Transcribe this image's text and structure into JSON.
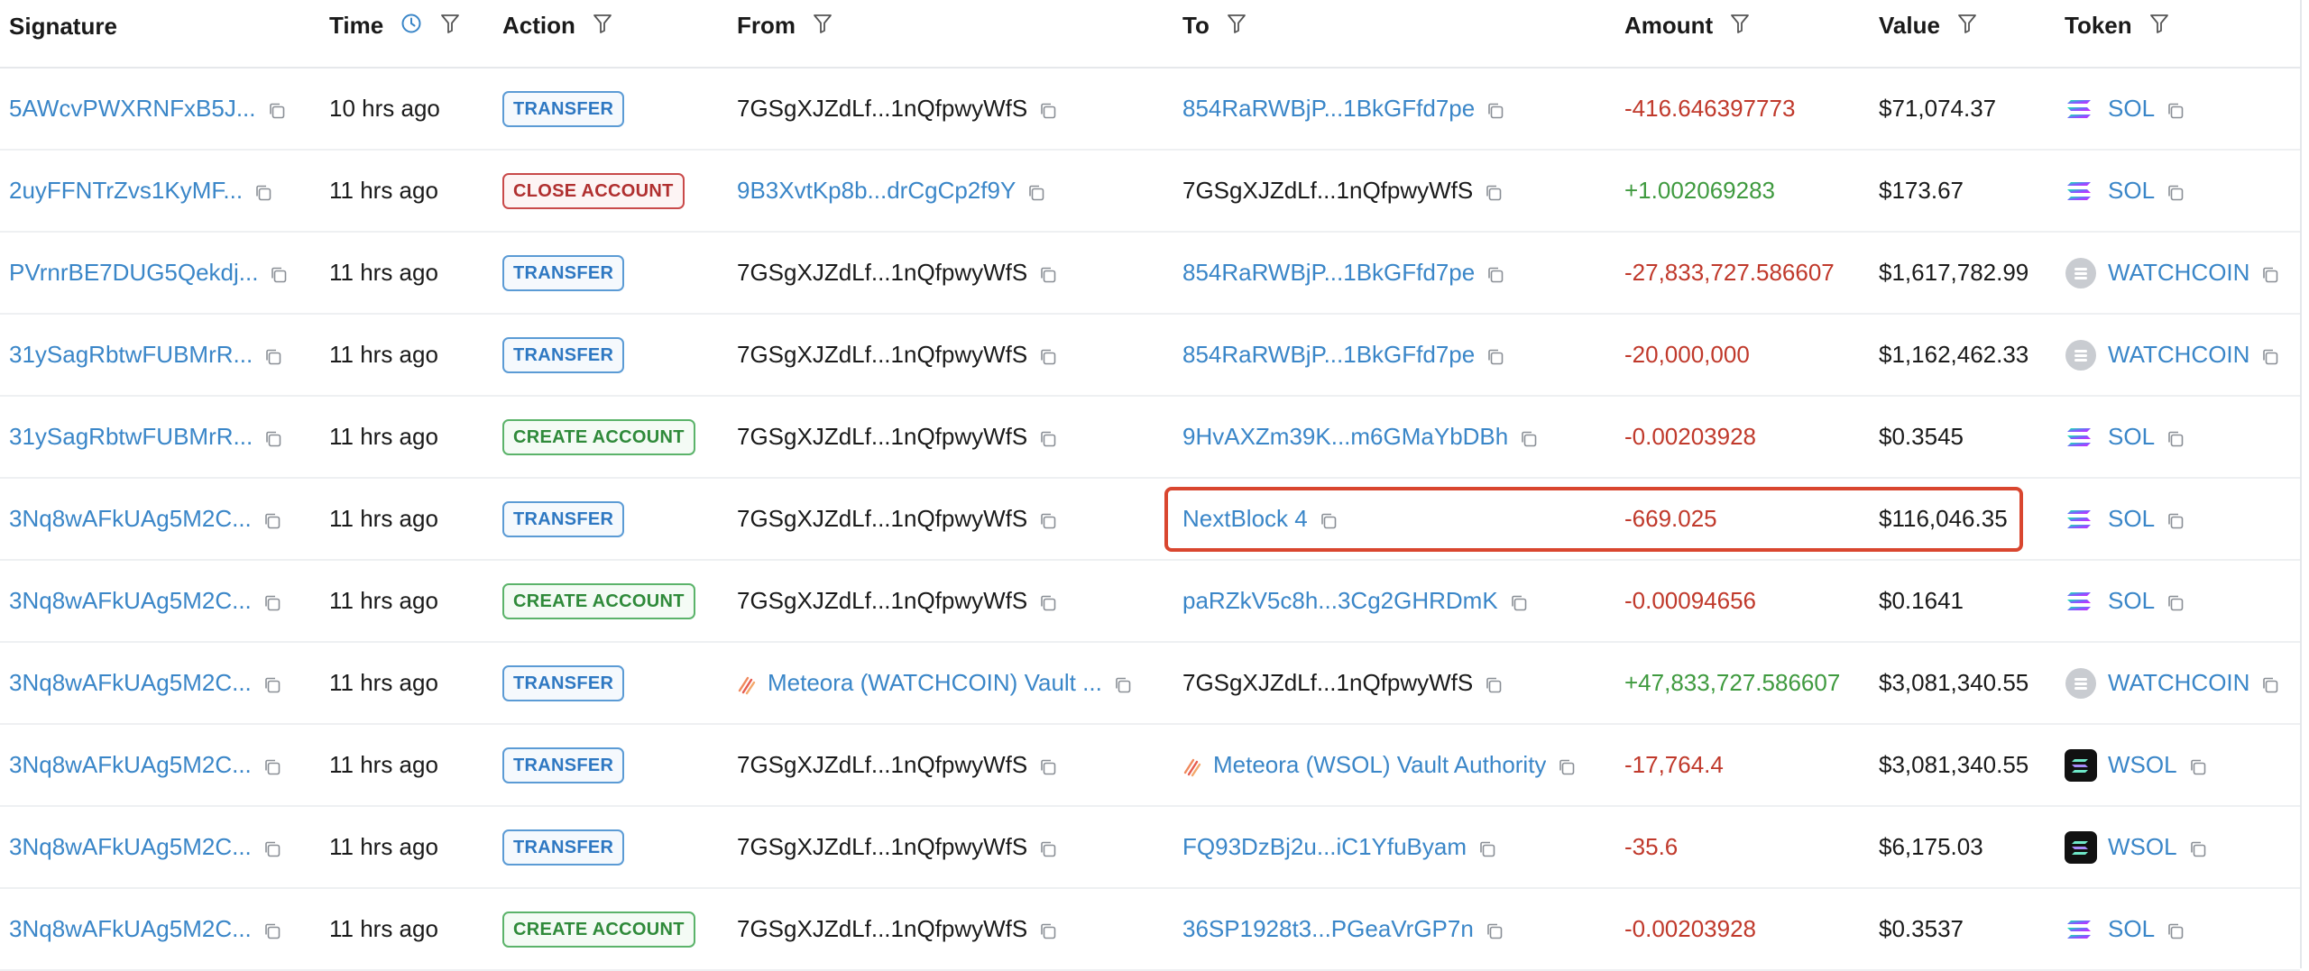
{
  "table": {
    "headers": {
      "signature": "Signature",
      "time": "Time",
      "action": "Action",
      "from": "From",
      "to": "To",
      "amount": "Amount",
      "value": "Value",
      "token": "Token"
    },
    "rows": [
      {
        "signature": "5AWcvPWXRNFxB5J...",
        "time": "10 hrs ago",
        "action": "TRANSFER",
        "action_type": "transfer",
        "from": "7GSgXJZdLf...1nQfpwyWfS",
        "from_link": false,
        "from_meteora": false,
        "to": "854RaRWBjP...1BkGFfd7pe",
        "to_link": true,
        "to_meteora": false,
        "amount": "-416.646397773",
        "amount_sign": "neg",
        "value": "$71,074.37",
        "token": "SOL",
        "token_icon": "sol-icon"
      },
      {
        "signature": "2uyFFNTrZvs1KyMF...",
        "time": "11 hrs ago",
        "action": "CLOSE ACCOUNT",
        "action_type": "close",
        "from": "9B3XvtKp8b...drCgCp2f9Y",
        "from_link": true,
        "from_meteora": false,
        "to": "7GSgXJZdLf...1nQfpwyWfS",
        "to_link": false,
        "to_meteora": false,
        "amount": "+1.002069283",
        "amount_sign": "pos",
        "value": "$173.67",
        "token": "SOL",
        "token_icon": "sol-icon"
      },
      {
        "signature": "PVrnrBE7DUG5Qekdj...",
        "time": "11 hrs ago",
        "action": "TRANSFER",
        "action_type": "transfer",
        "from": "7GSgXJZdLf...1nQfpwyWfS",
        "from_link": false,
        "from_meteora": false,
        "to": "854RaRWBjP...1BkGFfd7pe",
        "to_link": true,
        "to_meteora": false,
        "amount": "-27,833,727.586607",
        "amount_sign": "neg",
        "value": "$1,617,782.99",
        "token": "WATCHCOIN",
        "token_icon": "watchcoin-icon"
      },
      {
        "signature": "31ySagRbtwFUBMrR...",
        "time": "11 hrs ago",
        "action": "TRANSFER",
        "action_type": "transfer",
        "from": "7GSgXJZdLf...1nQfpwyWfS",
        "from_link": false,
        "from_meteora": false,
        "to": "854RaRWBjP...1BkGFfd7pe",
        "to_link": true,
        "to_meteora": false,
        "amount": "-20,000,000",
        "amount_sign": "neg",
        "value": "$1,162,462.33",
        "token": "WATCHCOIN",
        "token_icon": "watchcoin-icon"
      },
      {
        "signature": "31ySagRbtwFUBMrR...",
        "time": "11 hrs ago",
        "action": "CREATE ACCOUNT",
        "action_type": "create",
        "from": "7GSgXJZdLf...1nQfpwyWfS",
        "from_link": false,
        "from_meteora": false,
        "to": "9HvAXZm39K...m6GMaYbDBh",
        "to_link": true,
        "to_meteora": false,
        "amount": "-0.00203928",
        "amount_sign": "neg",
        "value": "$0.3545",
        "token": "SOL",
        "token_icon": "sol-icon"
      },
      {
        "signature": "3Nq8wAFkUAg5M2C...",
        "time": "11 hrs ago",
        "action": "TRANSFER",
        "action_type": "transfer",
        "from": "7GSgXJZdLf...1nQfpwyWfS",
        "from_link": false,
        "from_meteora": false,
        "to": "NextBlock 4",
        "to_link": true,
        "to_meteora": false,
        "amount": "-669.025",
        "amount_sign": "neg",
        "value": "$116,046.35",
        "token": "SOL",
        "token_icon": "sol-icon"
      },
      {
        "signature": "3Nq8wAFkUAg5M2C...",
        "time": "11 hrs ago",
        "action": "CREATE ACCOUNT",
        "action_type": "create",
        "from": "7GSgXJZdLf...1nQfpwyWfS",
        "from_link": false,
        "from_meteora": false,
        "to": "paRZkV5c8h...3Cg2GHRDmK",
        "to_link": true,
        "to_meteora": false,
        "amount": "-0.00094656",
        "amount_sign": "neg",
        "value": "$0.1641",
        "token": "SOL",
        "token_icon": "sol-icon"
      },
      {
        "signature": "3Nq8wAFkUAg5M2C...",
        "time": "11 hrs ago",
        "action": "TRANSFER",
        "action_type": "transfer",
        "from": "Meteora (WATCHCOIN) Vault ...",
        "from_link": true,
        "from_meteora": true,
        "to": "7GSgXJZdLf...1nQfpwyWfS",
        "to_link": false,
        "to_meteora": false,
        "amount": "+47,833,727.586607",
        "amount_sign": "pos",
        "value": "$3,081,340.55",
        "token": "WATCHCOIN",
        "token_icon": "watchcoin-icon"
      },
      {
        "signature": "3Nq8wAFkUAg5M2C...",
        "time": "11 hrs ago",
        "action": "TRANSFER",
        "action_type": "transfer",
        "from": "7GSgXJZdLf...1nQfpwyWfS",
        "from_link": false,
        "from_meteora": false,
        "to": "Meteora (WSOL) Vault Authority",
        "to_link": true,
        "to_meteora": true,
        "amount": "-17,764.4",
        "amount_sign": "neg",
        "value": "$3,081,340.55",
        "token": "WSOL",
        "token_icon": "wsol-icon"
      },
      {
        "signature": "3Nq8wAFkUAg5M2C...",
        "time": "11 hrs ago",
        "action": "TRANSFER",
        "action_type": "transfer",
        "from": "7GSgXJZdLf...1nQfpwyWfS",
        "from_link": false,
        "from_meteora": false,
        "to": "FQ93DzBj2u...iC1YfuByam",
        "to_link": true,
        "to_meteora": false,
        "amount": "-35.6",
        "amount_sign": "neg",
        "value": "$6,175.03",
        "token": "WSOL",
        "token_icon": "wsol-icon"
      },
      {
        "signature": "3Nq8wAFkUAg5M2C...",
        "time": "11 hrs ago",
        "action": "CREATE ACCOUNT",
        "action_type": "create",
        "from": "7GSgXJZdLf...1nQfpwyWfS",
        "from_link": false,
        "from_meteora": false,
        "to": "36SP1928t3...PGeaVrGP7n",
        "to_link": true,
        "to_meteora": false,
        "amount": "-0.00203928",
        "amount_sign": "neg",
        "value": "$0.3537",
        "token": "SOL",
        "token_icon": "sol-icon"
      }
    ]
  },
  "colors": {
    "link": "#3a86c8",
    "negative": "#c0392b",
    "positive": "#3f9a3f",
    "highlight": "#d9462f"
  }
}
